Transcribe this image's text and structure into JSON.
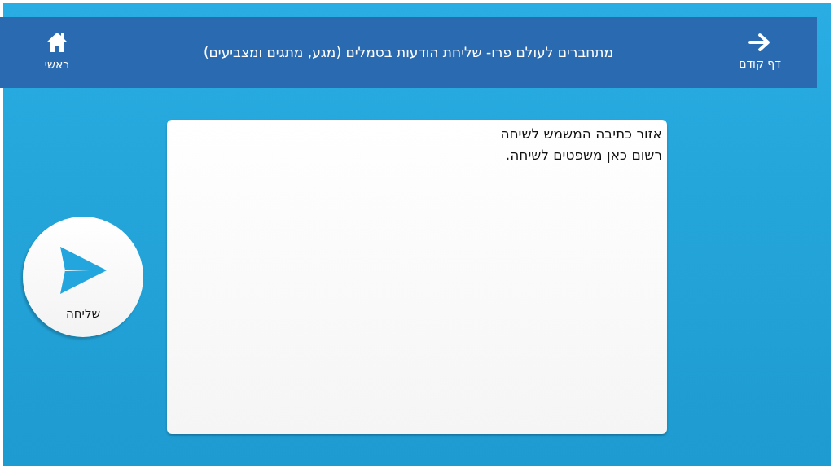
{
  "header": {
    "title": "מתחברים לעולם פרו- שליחת הודעות בסמלים (מגע, מתגים ומצביעים)",
    "nav": [
      {
        "kind": "back",
        "label": "דף קודם"
      },
      {
        "kind": "home",
        "label": "ראשי"
      }
    ]
  },
  "message_area": {
    "value": "אזור כתיבה המשמש לשיחה\nרשום כאן משפטים לשיחה."
  },
  "send_button": {
    "label": "שליחה"
  }
}
